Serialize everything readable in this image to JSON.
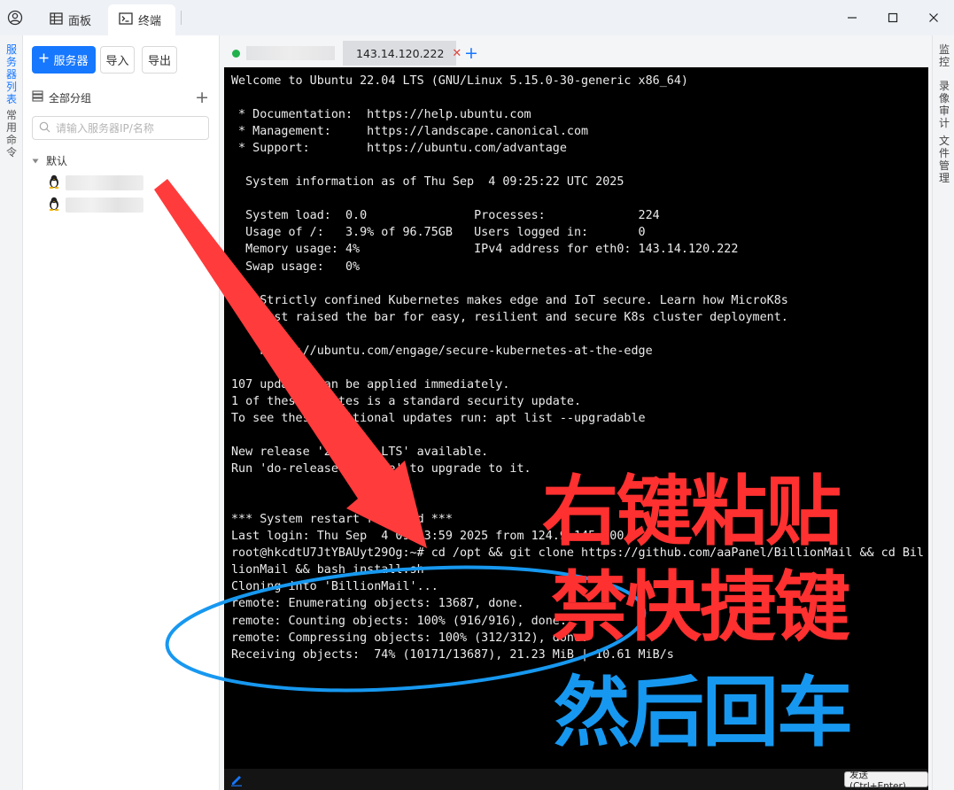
{
  "titlebar": {
    "tabs": [
      {
        "label": "面板",
        "icon": "table-icon"
      },
      {
        "label": "终端",
        "icon": "terminal-icon"
      }
    ],
    "active_tab": "终端"
  },
  "left_nav": {
    "items": [
      {
        "label": "服务器列表",
        "active": true
      },
      {
        "label": "常用命令",
        "active": false
      }
    ]
  },
  "sidebar": {
    "add_server_label": "服务器",
    "import_label": "导入",
    "export_label": "导出",
    "group_all_label": "全部分组",
    "search_placeholder": "请输入服务器IP/名称",
    "group_default_label": "默认",
    "servers": [
      {
        "icon": "linux-penguin-icon",
        "name_redacted": true
      },
      {
        "icon": "linux-penguin-icon",
        "name_redacted": true
      }
    ]
  },
  "terminal_tabs": [
    {
      "label": "",
      "status_color": "#22b14c",
      "redacted": true
    },
    {
      "label": "143.14.120.222",
      "status_color": "#d7a62f",
      "active": true
    }
  ],
  "terminal": {
    "lines": [
      "Welcome to Ubuntu 22.04 LTS (GNU/Linux 5.15.0-30-generic x86_64)",
      "",
      " * Documentation:  https://help.ubuntu.com",
      " * Management:     https://landscape.canonical.com",
      " * Support:        https://ubuntu.com/advantage",
      "",
      "  System information as of Thu Sep  4 09:25:22 UTC 2025",
      "",
      "  System load:  0.0               Processes:             224",
      "  Usage of /:   3.9% of 96.75GB   Users logged in:       0",
      "  Memory usage: 4%                IPv4 address for eth0: 143.14.120.222",
      "  Swap usage:   0%",
      "",
      "  * Strictly confined Kubernetes makes edge and IoT secure. Learn how MicroK8s",
      "    just raised the bar for easy, resilient and secure K8s cluster deployment.",
      "",
      "    https://ubuntu.com/engage/secure-kubernetes-at-the-edge",
      "",
      "107 updates can be applied immediately.",
      "1 of these updates is a standard security update.",
      "To see these additional updates run: apt list --upgradable",
      "",
      "New release '24.04.3 LTS' available.",
      "Run 'do-release-upgrade' to upgrade to it.",
      "",
      "",
      "*** System restart required ***",
      "Last login: Thu Sep  4 09:23:59 2025 from 124.9.145.100",
      "root@hkcdtU7JtYBAUyt29Og:~# cd /opt && git clone https://github.com/aaPanel/BillionMail && cd Bil",
      "lionMail && bash install.sh",
      "Cloning into 'BillionMail'...",
      "remote: Enumerating objects: 13687, done.",
      "remote: Counting objects: 100% (916/916), done.",
      "remote: Compressing objects: 100% (312/312), done.",
      "Receiving objects:  74% (10171/13687), 21.23 MiB | 10.61 MiB/s"
    ],
    "send_label": "发送(Ctrl+Enter)"
  },
  "right_nav": {
    "items": [
      {
        "label": "监控"
      },
      {
        "label": "录像审计"
      },
      {
        "label": "文件管理"
      }
    ]
  },
  "annotations": {
    "line1": "右键粘贴",
    "line2": "禁快捷键",
    "line3": "然后回车",
    "red_color": "#ff3030",
    "blue_color": "#1798f0"
  },
  "colors": {
    "accent": "#1677ff",
    "terminal_bg": "#000000",
    "terminal_fg": "#ececec"
  }
}
